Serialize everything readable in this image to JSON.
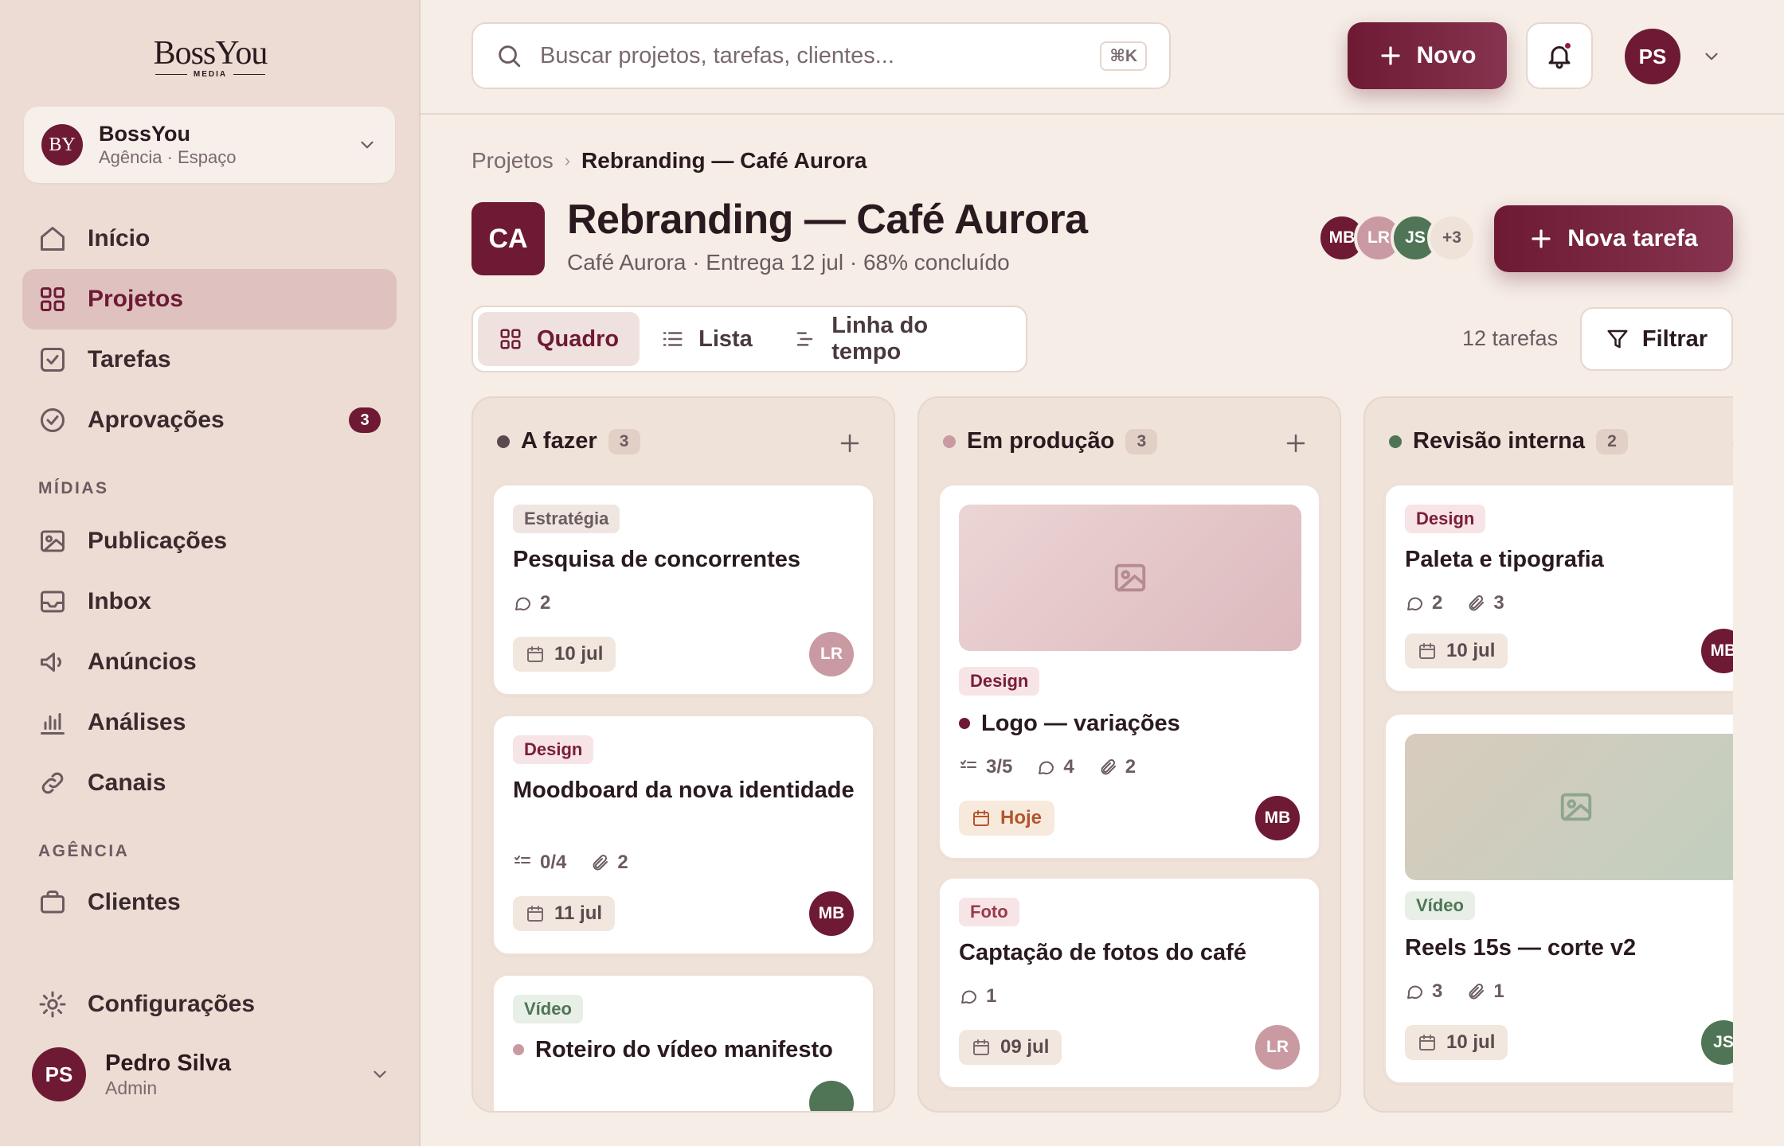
{
  "sidebar": {
    "logo": {
      "main": "BossYou",
      "sub": "MEDIA"
    },
    "workspace": {
      "initials": "BY",
      "name": "BossYou",
      "subtitle": "Agência · Espaço"
    },
    "nav": [
      {
        "label": "Início",
        "icon": "home-icon"
      },
      {
        "label": "Projetos",
        "icon": "grid-icon",
        "active": true
      },
      {
        "label": "Tarefas",
        "icon": "checkbox-icon"
      },
      {
        "label": "Aprovações",
        "icon": "check-circle-icon",
        "badge": "3"
      }
    ],
    "sections": {
      "midias": "MÍDIAS",
      "agencia": "AGÊNCIA"
    },
    "midias_items": [
      {
        "label": "Publicações",
        "icon": "image-icon"
      },
      {
        "label": "Inbox",
        "icon": "inbox-icon"
      },
      {
        "label": "Anúncios",
        "icon": "megaphone-icon"
      },
      {
        "label": "Análises",
        "icon": "bar-chart-icon"
      },
      {
        "label": "Canais",
        "icon": "link-icon"
      }
    ],
    "agencia_items": [
      {
        "label": "Clientes",
        "icon": "briefcase-icon"
      }
    ],
    "settings": {
      "label": "Configurações",
      "icon": "gear-icon"
    },
    "user": {
      "initials": "PS",
      "name": "Pedro Silva",
      "role": "Admin"
    }
  },
  "topbar": {
    "search_placeholder": "Buscar projetos, tarefas, clientes...",
    "search_shortcut": "⌘K",
    "new_button": "Novo",
    "avatar_initials": "PS"
  },
  "breadcrumb": {
    "parent": "Projetos",
    "separator": "›",
    "current": "Rebranding — Café Aurora"
  },
  "project": {
    "initials": "CA",
    "title": "Rebranding — Café Aurora",
    "meta": "Café Aurora · Entrega 12 jul · 68% concluído",
    "members": [
      {
        "initials": "MB",
        "color": "#6e1a34"
      },
      {
        "initials": "LR",
        "color": "#c99aa2"
      },
      {
        "initials": "JS",
        "color": "#4f7556"
      },
      {
        "initials": "+3",
        "color": "#efe2d9"
      }
    ],
    "new_task_button": "Nova tarefa"
  },
  "views": {
    "tabs": [
      {
        "label": "Quadro",
        "icon": "grid-icon",
        "active": true
      },
      {
        "label": "Lista",
        "icon": "list-icon"
      },
      {
        "label": "Linha do tempo",
        "icon": "timeline-icon"
      }
    ],
    "task_count": "12 tarefas",
    "filter_button": "Filtrar"
  },
  "board": {
    "columns": [
      {
        "title": "A fazer",
        "count": "3",
        "dot_color": "#5a4a4f",
        "cards": [
          {
            "tag": "Estratégia",
            "title": "Pesquisa de concorrentes",
            "comments": "2",
            "date": "10 jul",
            "assignee": "LR"
          },
          {
            "tag": "Design",
            "title": "Moodboard da nova identidade",
            "checklist": "0/4",
            "attachments": "2",
            "date": "11 jul",
            "assignee": "MB"
          },
          {
            "tag": "Vídeo",
            "title": "Roteiro do vídeo manifesto"
          }
        ]
      },
      {
        "title": "Em produção",
        "count": "3",
        "dot_color": "#c99aa2",
        "cards": [
          {
            "tag": "Design",
            "title": "Logo — variações",
            "checklist": "3/5",
            "comments": "4",
            "attachments": "2",
            "date": "Hoje",
            "assignee": "MB"
          },
          {
            "tag": "Foto",
            "title": "Captação de fotos do café",
            "comments": "1",
            "date": "09 jul",
            "assignee": "LR"
          }
        ]
      },
      {
        "title": "Revisão interna",
        "count": "2",
        "dot_color": "#4f7556",
        "cards": [
          {
            "tag": "Design",
            "title": "Paleta e tipografia",
            "comments": "2",
            "attachments": "3",
            "date": "10 jul",
            "assignee": "MB"
          },
          {
            "tag": "Vídeo",
            "title": "Reels 15s — corte v2",
            "comments": "3",
            "attachments": "1",
            "date": "10 jul",
            "assignee": "JS"
          }
        ]
      }
    ]
  }
}
